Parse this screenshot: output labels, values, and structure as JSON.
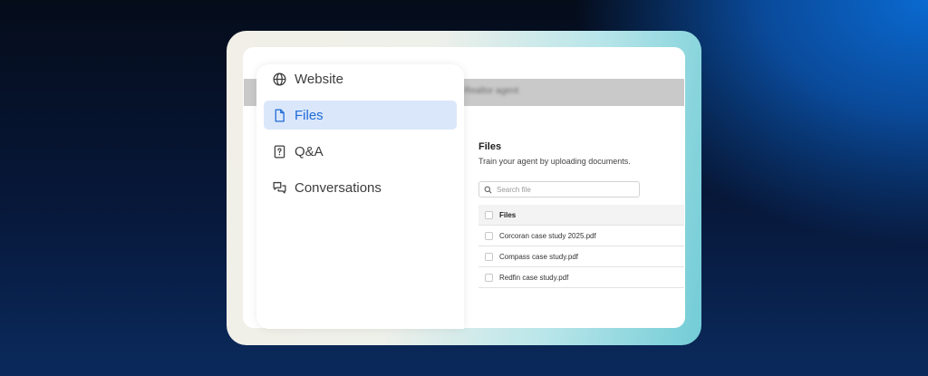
{
  "sidebar": {
    "items": [
      {
        "label": "Website",
        "icon": "globe-icon",
        "active": false
      },
      {
        "label": "Files",
        "icon": "file-icon",
        "active": true
      },
      {
        "label": "Q&A",
        "icon": "question-document-icon",
        "active": false
      },
      {
        "label": "Conversations",
        "icon": "chat-bubbles-icon",
        "active": false
      }
    ]
  },
  "header": {
    "agent_name": "Realtor agent"
  },
  "files_panel": {
    "title": "Files",
    "subtitle": "Train your agent by uploading documents.",
    "search": {
      "placeholder": "Search file",
      "value": ""
    },
    "table": {
      "header": "Files",
      "rows": [
        "Corcoran case study 2025.pdf",
        "Compass case study.pdf",
        "Redfin case study.pdf"
      ]
    }
  },
  "colors": {
    "accent": "#1e6ad8",
    "active_bg": "#dae7fa",
    "topbar": "#c9c9c9"
  }
}
